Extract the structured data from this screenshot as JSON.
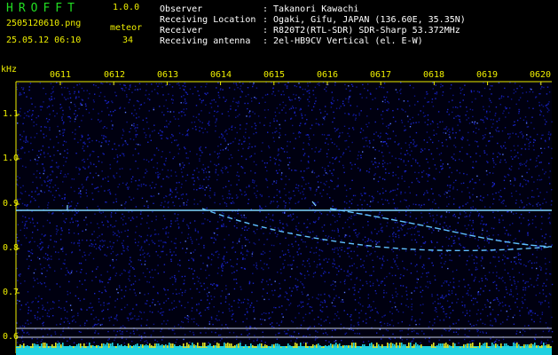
{
  "header": {
    "brand": "HROFFT",
    "version": "1.0.0",
    "filename": "2505120610.png",
    "meteor_label": "meteor",
    "datetime": "25.05.12 06:10",
    "meteor_count": "34"
  },
  "info": [
    {
      "key": "Observer",
      "value": ": Takanori Kawachi"
    },
    {
      "key": "Receiving Location",
      "value": ": Ogaki, Gifu, JAPAN (136.60E, 35.35N)"
    },
    {
      "key": "Receiver",
      "value": ": R820T2(RTL-SDR) SDR-Sharp 53.372MHz"
    },
    {
      "key": "Receiving antenna",
      "value": ": 2el-HB9CV Vertical (el. E-W)"
    }
  ],
  "axes": {
    "y_unit": "kHz",
    "y_ticks": [
      "1.1",
      "1.0",
      "0.9",
      "0.8",
      "0.7",
      "0.6"
    ],
    "x_ticks": [
      "0611",
      "0612",
      "0613",
      "0614",
      "0615",
      "0616",
      "0617",
      "0618",
      "0619",
      "0620"
    ]
  },
  "colors": {
    "background": "#000010",
    "noise": "#1a24c8",
    "carrier": "#80d8ff",
    "trail": "#60c0ff",
    "axis": "#eeee00",
    "baseline_cyan": "#20d0e0",
    "baseline_yellow": "#e0e020"
  }
}
